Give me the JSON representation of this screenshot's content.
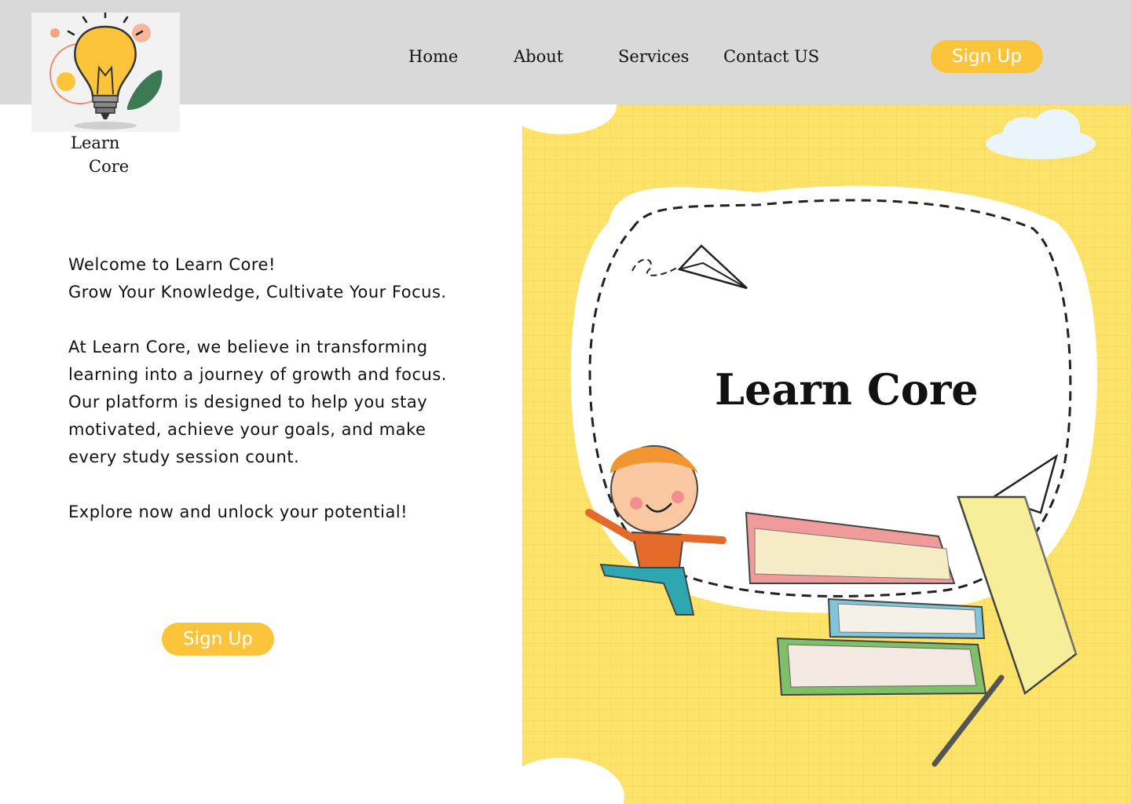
{
  "brand": {
    "line1": "Learn",
    "line2": "Core"
  },
  "nav": {
    "home": "Home",
    "about": "About",
    "services": "Services",
    "contact": "Contact US"
  },
  "header_cta": "Sign Up",
  "hero": {
    "welcome": "Welcome to Learn Core!",
    "tagline": "Grow Your Knowledge, Cultivate Your Focus.",
    "body": "At Learn Core, we believe in transforming learning into a journey of growth and focus. Our platform is designed to help you stay motivated, achieve your goals, and make every study session count.",
    "explore": "Explore now and unlock your potential!",
    "cta": "Sign Up"
  },
  "illustration": {
    "title": "Learn Core"
  },
  "colors": {
    "header_bg": "#d9d9d9",
    "accent": "#fcc43a",
    "panel_yellow": "#fde36a"
  }
}
